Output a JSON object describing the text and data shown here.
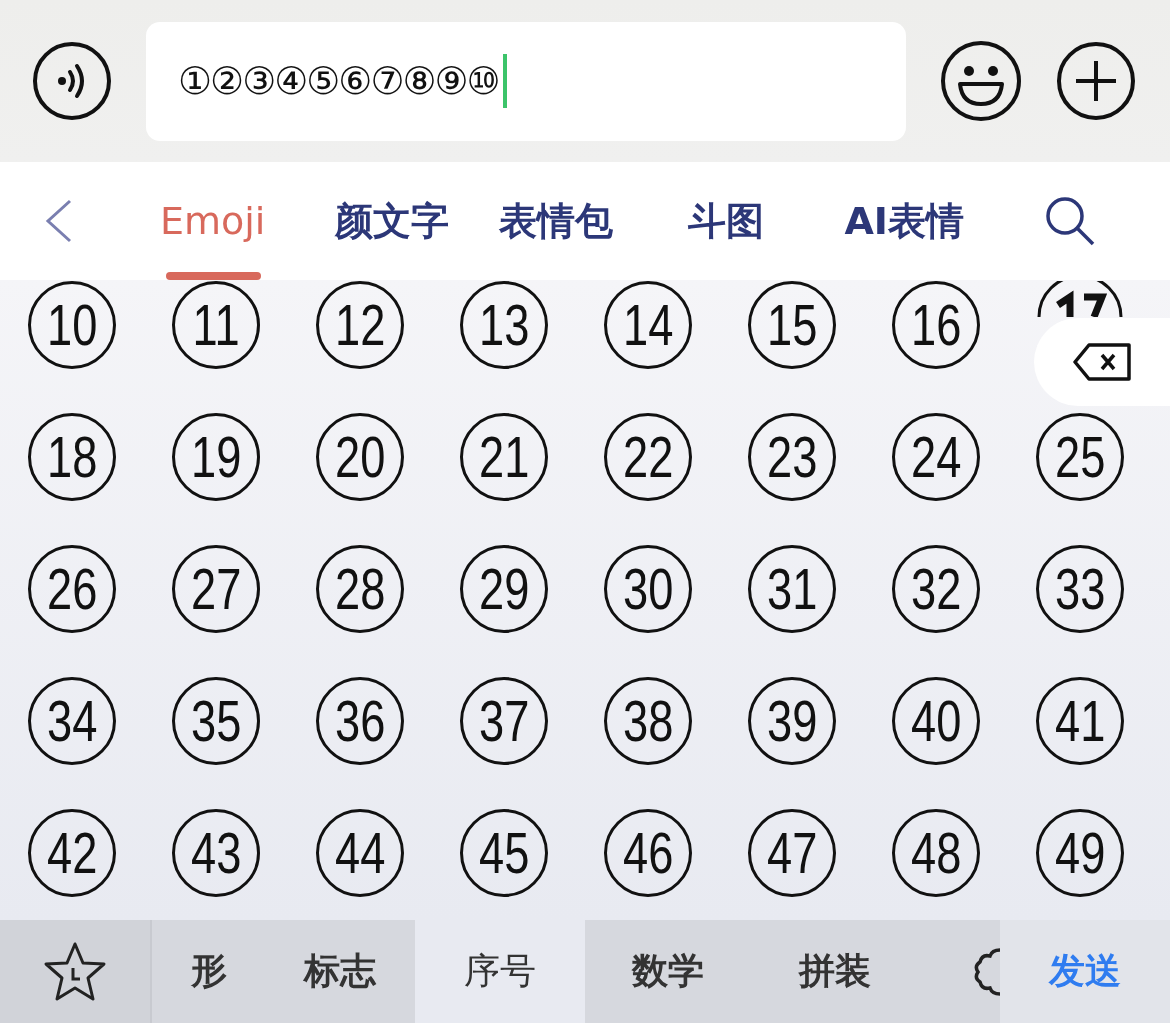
{
  "input": {
    "value": "①②③④⑤⑥⑦⑧⑨⑩"
  },
  "tabs": [
    {
      "label": "Emoji",
      "selected": true
    },
    {
      "label": "颜文字",
      "selected": false
    },
    {
      "label": "表情包",
      "selected": false
    },
    {
      "label": "斗图",
      "selected": false
    },
    {
      "label": "AI表情",
      "selected": false
    }
  ],
  "symbols": [
    {
      "kind": "key",
      "label": "10"
    },
    {
      "kind": "key",
      "label": "11"
    },
    {
      "kind": "key",
      "label": "12"
    },
    {
      "kind": "key",
      "label": "13"
    },
    {
      "kind": "key",
      "label": "14"
    },
    {
      "kind": "key",
      "label": "15"
    },
    {
      "kind": "key",
      "label": "16"
    },
    {
      "kind": "cut"
    },
    {
      "kind": "key",
      "label": "18"
    },
    {
      "kind": "key",
      "label": "19"
    },
    {
      "kind": "key",
      "label": "20"
    },
    {
      "kind": "key",
      "label": "21"
    },
    {
      "kind": "key",
      "label": "22"
    },
    {
      "kind": "key",
      "label": "23"
    },
    {
      "kind": "key",
      "label": "24"
    },
    {
      "kind": "key",
      "label": "25"
    },
    {
      "kind": "key",
      "label": "26"
    },
    {
      "kind": "key",
      "label": "27"
    },
    {
      "kind": "key",
      "label": "28"
    },
    {
      "kind": "key",
      "label": "29"
    },
    {
      "kind": "key",
      "label": "30"
    },
    {
      "kind": "key",
      "label": "31"
    },
    {
      "kind": "key",
      "label": "32"
    },
    {
      "kind": "key",
      "label": "33"
    },
    {
      "kind": "key",
      "label": "34"
    },
    {
      "kind": "key",
      "label": "35"
    },
    {
      "kind": "key",
      "label": "36"
    },
    {
      "kind": "key",
      "label": "37"
    },
    {
      "kind": "key",
      "label": "38"
    },
    {
      "kind": "key",
      "label": "39"
    },
    {
      "kind": "key",
      "label": "40"
    },
    {
      "kind": "key",
      "label": "41"
    },
    {
      "kind": "key",
      "label": "42"
    },
    {
      "kind": "key",
      "label": "43"
    },
    {
      "kind": "key",
      "label": "44"
    },
    {
      "kind": "key",
      "label": "45"
    },
    {
      "kind": "key",
      "label": "46"
    },
    {
      "kind": "key",
      "label": "47"
    },
    {
      "kind": "key",
      "label": "48"
    },
    {
      "kind": "key",
      "label": "49"
    }
  ],
  "categories": [
    {
      "label": "形",
      "selected": false
    },
    {
      "label": "标志",
      "selected": false
    },
    {
      "label": "序号",
      "selected": true
    },
    {
      "label": "数学",
      "selected": false
    },
    {
      "label": "拼装",
      "selected": false
    }
  ],
  "send_button": "发送"
}
